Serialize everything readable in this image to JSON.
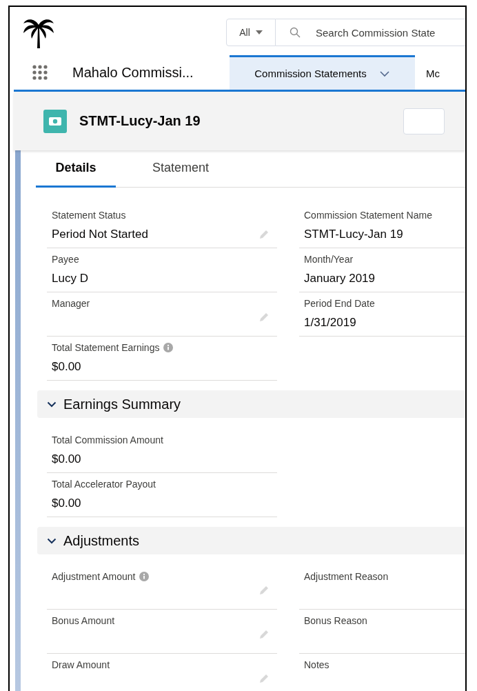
{
  "header": {
    "search": {
      "scope": "All",
      "placeholder": "Search Commission State"
    },
    "app_name": "Mahalo Commissi...",
    "nav_tabs": [
      {
        "label": "Commission Statements",
        "selected": true,
        "has_menu": true
      },
      {
        "label": "Mc",
        "selected": false,
        "has_menu": false
      }
    ]
  },
  "record": {
    "title": "STMT-Lucy-Jan 19"
  },
  "tabs": [
    {
      "label": "Details",
      "selected": true
    },
    {
      "label": "Statement",
      "selected": false
    }
  ],
  "sections": [
    {
      "rows": [
        [
          {
            "label": "Statement Status",
            "value": "Period Not Started",
            "editable": true,
            "info": false
          },
          {
            "label": "Commission Statement Name",
            "value": "STMT-Lucy-Jan 19",
            "editable": false,
            "info": false
          }
        ],
        [
          {
            "label": "Payee",
            "value": "Lucy D",
            "editable": false,
            "info": false
          },
          {
            "label": "Month/Year",
            "value": "January 2019",
            "editable": false,
            "info": false
          }
        ],
        [
          {
            "label": "Manager",
            "editable": true,
            "info": false
          },
          {
            "label": "Period End Date",
            "value": "1/31/2019",
            "editable": false,
            "info": false
          }
        ],
        [
          {
            "label": "Total Statement Earnings",
            "value": "$0.00",
            "editable": false,
            "info": true
          }
        ]
      ]
    },
    {
      "title": "Earnings Summary",
      "expanded": true,
      "rows": [
        [
          {
            "label": "Total Commission Amount",
            "value": "$0.00",
            "editable": false,
            "info": false
          }
        ],
        [
          {
            "label": "Total Accelerator Payout",
            "value": "$0.00",
            "editable": false,
            "info": false
          }
        ]
      ]
    },
    {
      "title": "Adjustments",
      "expanded": true,
      "rows": [
        [
          {
            "label": "Adjustment Amount",
            "editable": true,
            "info": true
          },
          {
            "label": "Adjustment Reason",
            "editable": false,
            "info": false
          }
        ],
        [
          {
            "label": "Bonus Amount",
            "editable": true,
            "info": false
          },
          {
            "label": "Bonus Reason",
            "editable": false,
            "info": false
          }
        ],
        [
          {
            "label": "Draw Amount",
            "editable": true,
            "info": false
          },
          {
            "label": "Notes",
            "editable": false,
            "info": false
          }
        ]
      ]
    }
  ]
}
